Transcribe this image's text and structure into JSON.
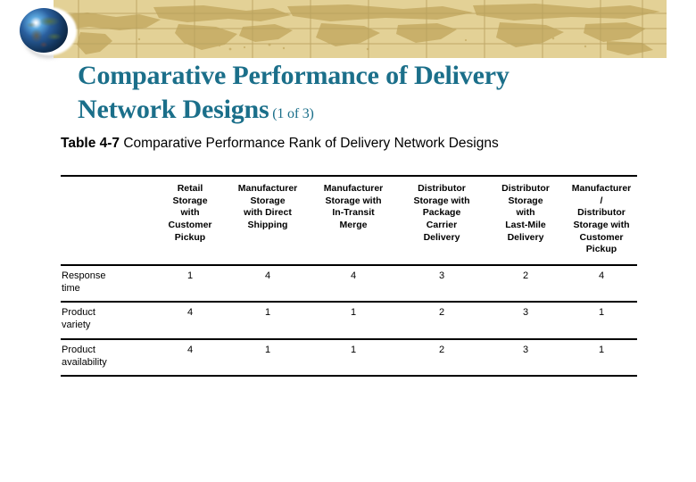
{
  "slide": {
    "title_line1": "Comparative Performance of Delivery",
    "title_line2": "Network Designs",
    "title_suffix": "(1 of 3)",
    "title_color": "#1b6f8a"
  },
  "banner": {
    "icon": "globe-icon",
    "background_color": "#e3d196",
    "landmass_color": "#c9b06a",
    "gridline_color": "#b9a15f"
  },
  "table": {
    "caption_strong": "Table 4-7",
    "caption_rest": "Comparative Performance Rank of Delivery Network Designs",
    "row_label_header": "",
    "columns": [
      "Retail Storage with Customer Pickup",
      "Manufacturer Storage with Direct Shipping",
      "Manufacturer Storage with In-Transit Merge",
      "Distributor Storage with Package Carrier Delivery",
      "Distributor Storage with Last-Mile Delivery",
      "Manufacturer / Distributor Storage with Customer Pickup"
    ],
    "column_lines": [
      [
        "Retail",
        "Storage",
        "with",
        "Customer",
        "Pickup"
      ],
      [
        "Manufacturer",
        "Storage",
        "with Direct",
        "Shipping"
      ],
      [
        "Manufacturer",
        "Storage with",
        "In-Transit",
        "Merge"
      ],
      [
        "Distributor",
        "Storage with",
        "Package",
        "Carrier",
        "Delivery"
      ],
      [
        "Distributor",
        "Storage",
        "with",
        "Last-Mile",
        "Delivery"
      ],
      [
        "Manufacturer",
        "/",
        "Distributor",
        "Storage with",
        "Customer",
        "Pickup"
      ]
    ],
    "rows": [
      {
        "label_lines": [
          "Response",
          "time"
        ],
        "label": "Response time",
        "values": [
          "1",
          "4",
          "4",
          "3",
          "2",
          "4"
        ]
      },
      {
        "label_lines": [
          "Product",
          "variety"
        ],
        "label": "Product variety",
        "values": [
          "4",
          "1",
          "1",
          "2",
          "3",
          "1"
        ]
      },
      {
        "label_lines": [
          "Product",
          "availability"
        ],
        "label": "Product availability",
        "values": [
          "4",
          "1",
          "1",
          "2",
          "3",
          "1"
        ]
      }
    ]
  }
}
